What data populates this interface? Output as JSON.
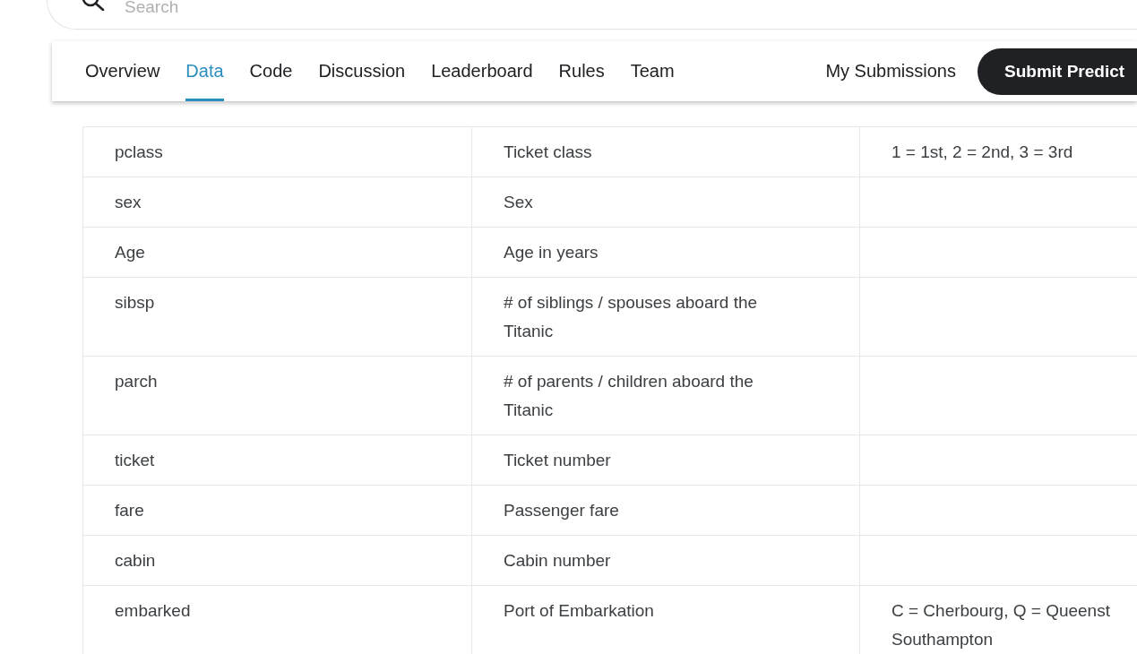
{
  "search": {
    "placeholder": "Search"
  },
  "tabs": [
    {
      "label": "Overview",
      "selected": false
    },
    {
      "label": "Data",
      "selected": true
    },
    {
      "label": "Code",
      "selected": false
    },
    {
      "label": "Discussion",
      "selected": false
    },
    {
      "label": "Leaderboard",
      "selected": false
    },
    {
      "label": "Rules",
      "selected": false
    },
    {
      "label": "Team",
      "selected": false
    }
  ],
  "my_submissions": "My Submissions",
  "submit_button": "Submit Predict",
  "table": {
    "rows": [
      {
        "column_1": "pclass",
        "column_2": [
          "Ticket class"
        ],
        "column_3": [
          "1 = 1st, 2 = 2nd, 3 = 3rd"
        ]
      },
      {
        "column_1": "sex",
        "column_2": [
          "Sex"
        ]
      },
      {
        "column_1": "Age",
        "column_2": [
          "Age in years"
        ]
      },
      {
        "column_1": "sibsp",
        "column_2": [
          "# of siblings / spouses aboard the",
          "Titanic"
        ]
      },
      {
        "column_1": "parch",
        "column_2": [
          "# of parents / children aboard the",
          "Titanic"
        ]
      },
      {
        "column_1": "ticket",
        "column_2": [
          "Ticket number"
        ]
      },
      {
        "column_1": "fare",
        "column_2": [
          "Passenger fare"
        ]
      },
      {
        "column_1": "cabin",
        "column_2": [
          "Cabin number"
        ]
      },
      {
        "column_1": "embarked",
        "column_2": [
          "Port of Embarkation"
        ],
        "column_3": [
          "C = Cherbourg, Q = Queenst",
          "Southampton"
        ]
      }
    ]
  }
}
